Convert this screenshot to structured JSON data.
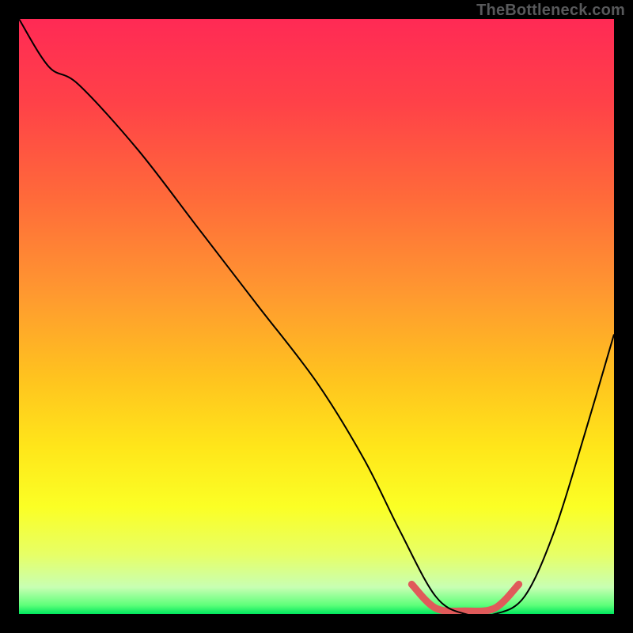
{
  "watermark": "TheBottleneck.com",
  "chart_data": {
    "type": "line",
    "title": "",
    "xlabel": "",
    "ylabel": "",
    "xlim": [
      0,
      100
    ],
    "ylim": [
      0,
      100
    ],
    "grid": false,
    "series": [
      {
        "name": "bottleneck-curve",
        "x": [
          0,
          5,
          10,
          20,
          30,
          40,
          50,
          58,
          64,
          70,
          75,
          80,
          85,
          90,
          95,
          100
        ],
        "y": [
          100,
          92,
          89,
          78,
          65,
          52,
          39,
          26,
          14,
          3,
          0,
          0,
          3,
          14,
          30,
          47
        ],
        "color": "#000000"
      }
    ],
    "highlight_segment": {
      "x": [
        66,
        70,
        75,
        80,
        84
      ],
      "y": [
        5,
        1,
        0.5,
        1,
        5
      ],
      "color": "#e05a5a",
      "width": 9
    },
    "background_gradient_stops": [
      {
        "offset": 0.0,
        "color": "#ff2a55"
      },
      {
        "offset": 0.14,
        "color": "#ff4148"
      },
      {
        "offset": 0.3,
        "color": "#ff6a3a"
      },
      {
        "offset": 0.46,
        "color": "#ff9830"
      },
      {
        "offset": 0.6,
        "color": "#ffc21f"
      },
      {
        "offset": 0.72,
        "color": "#ffe61a"
      },
      {
        "offset": 0.82,
        "color": "#fbff25"
      },
      {
        "offset": 0.9,
        "color": "#e7ff66"
      },
      {
        "offset": 0.955,
        "color": "#c8ffb3"
      },
      {
        "offset": 0.985,
        "color": "#5fff7a"
      },
      {
        "offset": 1.0,
        "color": "#00e85e"
      }
    ]
  }
}
